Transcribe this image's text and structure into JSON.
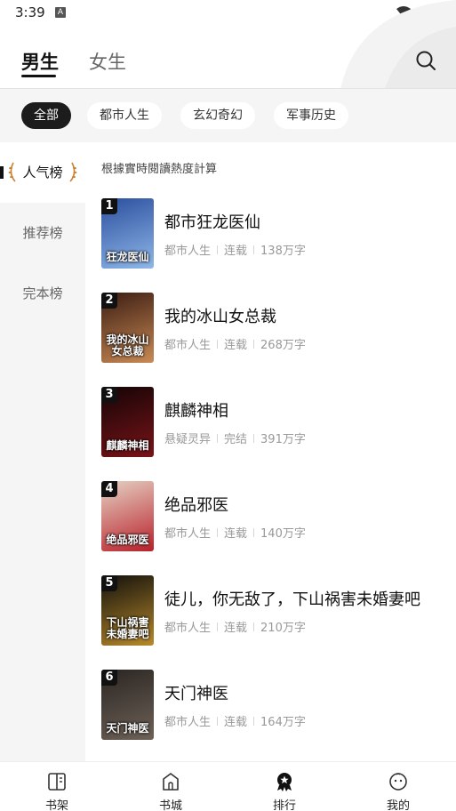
{
  "status_bar": {
    "time": "3:39",
    "notification_glyph": "A"
  },
  "header": {
    "tabs": [
      {
        "label": "男生",
        "active": true
      },
      {
        "label": "女生",
        "active": false
      }
    ],
    "search_icon": "search-icon"
  },
  "categories": [
    {
      "label": "全部",
      "active": true
    },
    {
      "label": "都市人生",
      "active": false
    },
    {
      "label": "玄幻奇幻",
      "active": false
    },
    {
      "label": "军事历史",
      "active": false
    }
  ],
  "sidebar": {
    "items": [
      {
        "label": "人气榜",
        "active": true
      },
      {
        "label": "推荐榜",
        "active": false
      },
      {
        "label": "完本榜",
        "active": false
      }
    ]
  },
  "list": {
    "subtitle": "根據實時閱讀熱度計算",
    "books": [
      {
        "rank": "1",
        "title": "都市狂龙医仙",
        "genre": "都市人生",
        "status": "连载",
        "words": "138万字",
        "cover_text": "狂龙医仙",
        "cover_colors": [
          "#2b4f9e",
          "#8fb7e8"
        ]
      },
      {
        "rank": "2",
        "title": "我的冰山女总裁",
        "genre": "都市人生",
        "status": "连载",
        "words": "268万字",
        "cover_text": "我的冰山女总裁",
        "cover_colors": [
          "#3b1d12",
          "#c98a55"
        ]
      },
      {
        "rank": "3",
        "title": "麒麟神相",
        "genre": "悬疑灵异",
        "status": "完结",
        "words": "391万字",
        "cover_text": "麒麟神相",
        "cover_colors": [
          "#140406",
          "#7a1418"
        ]
      },
      {
        "rank": "4",
        "title": "绝品邪医",
        "genre": "都市人生",
        "status": "连载",
        "words": "140万字",
        "cover_text": "绝品邪医",
        "cover_colors": [
          "#e6d2c4",
          "#b8202a"
        ]
      },
      {
        "rank": "5",
        "title": "徒儿，你无敌了，下山祸害未婚妻吧",
        "genre": "都市人生",
        "status": "连载",
        "words": "210万字",
        "cover_text": "下山祸害未婚妻吧",
        "cover_colors": [
          "#12100c",
          "#b88a2c"
        ]
      },
      {
        "rank": "6",
        "title": "天门神医",
        "genre": "都市人生",
        "status": "连载",
        "words": "164万字",
        "cover_text": "天门神医",
        "cover_colors": [
          "#2a2522",
          "#6e6258"
        ]
      }
    ]
  },
  "bottom_nav": [
    {
      "label": "书架",
      "icon": "bookshelf-icon"
    },
    {
      "label": "书城",
      "icon": "bookstore-icon"
    },
    {
      "label": "排行",
      "icon": "ranking-icon"
    },
    {
      "label": "我的",
      "icon": "profile-icon"
    }
  ],
  "colors": {
    "accent": "#111111",
    "chip_bg": "#f5f5f5",
    "muted_text": "#999999",
    "laurel": "#c9822e"
  }
}
